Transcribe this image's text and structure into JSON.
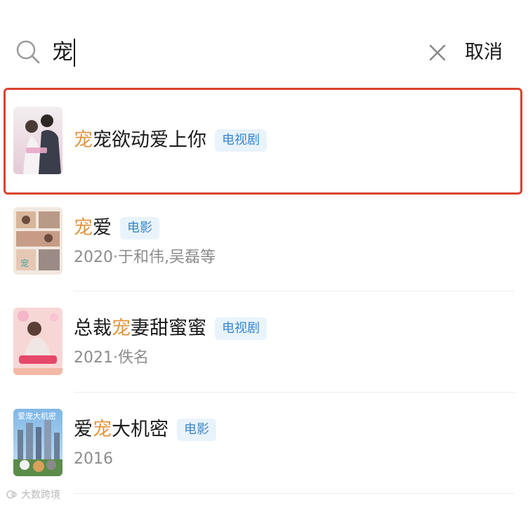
{
  "search": {
    "query": "宠",
    "cancel_label": "取消"
  },
  "results": [
    {
      "pre": "",
      "hl": "宠",
      "post": "宠欲动爱上你",
      "tag": "电视剧",
      "meta": ""
    },
    {
      "pre": "",
      "hl": "宠",
      "post": "爱",
      "tag": "电影",
      "meta": "2020·于和伟,吴磊等"
    },
    {
      "pre": "总裁",
      "hl": "宠",
      "post": "妻甜蜜蜜",
      "tag": "电视剧",
      "meta": "2021·佚名"
    },
    {
      "pre": "爱",
      "hl": "宠",
      "post": "大机密",
      "tag": "电影",
      "meta": "2016"
    }
  ],
  "watermark": "大数跨境",
  "colors": {
    "highlight_text": "#e2963f",
    "selection_border": "#d9432f",
    "tag_text": "#3a86cc",
    "tag_bg": "#e9f3fc"
  }
}
